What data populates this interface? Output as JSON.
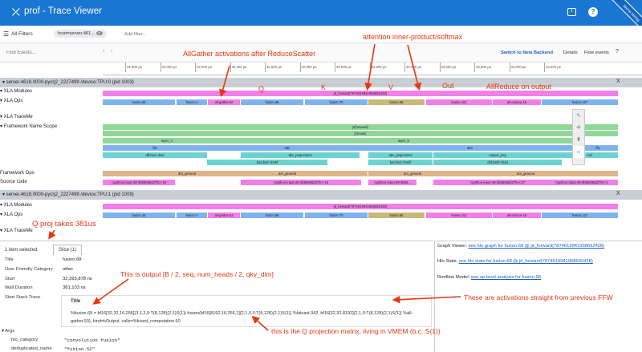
{
  "app": {
    "title": "prof - Trace Viewer",
    "hiring": "We're Hiring"
  },
  "filters": {
    "all_filters": "All Filters",
    "host_chip": "host=server.461...",
    "add_filter_placeholder": "Add filter..."
  },
  "search": {
    "placeholder": "Find Events...",
    "switch_backend": "Switch to New Backend",
    "details": "Details",
    "flow_events": "Flow events"
  },
  "ruler": {
    "ticks": [
      "31,800 µs",
      "32,000 µs",
      "32,200 µs",
      "32,400 µs",
      "32,600 µs",
      "32,800 µs",
      "33,000 µs",
      "33,200 µs",
      "33,400 µs",
      "33,600 µs",
      "33,800 µs",
      "34,000 µs",
      "34,200 µs"
    ]
  },
  "process1": {
    "header": "▾ server.4618.0000-pycrj2_2227499 /device:TPU:0 (pid 1003)",
    "rows": [
      "▾ XLA Modules",
      "▾ XLA Ops",
      "▾ XLA TraceMe",
      "▾ Framework Name Scope",
      "Framework Ops",
      "Source code"
    ],
    "module": "jit_forward(7874619941958692428)",
    "ops": [
      "fusion.28",
      "fusion.4",
      "all-gather.52",
      "fusion.68",
      "fusion.70",
      "fusion.66",
      "fusion.151",
      "all-reduce.15",
      "fusion.127"
    ],
    "scope_top": "jit(forward)",
    "scope_main": "jit(main)",
    "layer4": "layer_4",
    "layer5a": "layer_5",
    "layer5b": "layer_5",
    "ffw": "ffw",
    "attn": "attn",
    "attn2": "attn",
    "ffw2": "ffw",
    "ffw_right": "ffw",
    "einsum_left": "dff,bsd->bsd",
    "qkv1": "qkv_projections",
    "qkv2": "qkv_projections",
    "out_proj": "output_proj",
    "einsum_right": "bsf",
    "bsd1": "bsd,bsd->bshf",
    "bsd2": "bsd,bsd->bshf",
    "dhf": "dhf,bshf->bsd",
    "dot1": "dot_general",
    "dot2": "dot_general",
    "dot3": "dot_general",
    "dot4": "dot_general",
    "src1": "<python-input-49-3b56066d27fe>:19",
    "src2": "<python-input-49-3b56066d27fe>:19",
    "src3": "<python-input-49-3b56...",
    "src4": "<python-input-49-3b56066d27fe>:27",
    "src5": "<python-input-49-3b56066d27fe>:1"
  },
  "process2": {
    "header": "▾ server.4618.0000-pycrj2_2227499 /device:TPU:1 (pid 1009)",
    "rows": [
      "▾ XLA Modules",
      "▾ XLA Ops",
      "▾ XLA TraceMe"
    ],
    "module": "jit_forward(7874619941958692428)",
    "ops": [
      "fusion.28",
      "fusion.4",
      "all-gather.53",
      "fusion.68",
      "fusion.70",
      "fusion.66",
      "fusion.151",
      "all-reduce.15",
      "fusion.127"
    ]
  },
  "details": {
    "selected": "1 item selected.",
    "tab": "Slice (1)",
    "fields": [
      {
        "label": "Title",
        "value": "fusion.68"
      },
      {
        "label": "User Friendly Category",
        "value": "other"
      },
      {
        "label": "Start",
        "value": "32,393,878 ns"
      },
      {
        "label": "Wall Duration",
        "value": "381,103 ns"
      },
      {
        "label": "Start Stack Trace",
        "value": ""
      }
    ],
    "stack_title": "Title",
    "stack_text": "%fusion.68 = bf16[32,32,16,256]{3,1,2,0:T(8,128)(2,1)S(1)} fusion(bf16[8192,16,256,1]{2,1,0,3:T(8,128)(2,1)S(1)} %bitcast.342, bf16[32,32,8192]{2,1,0:T(8,128)(2,1)S(1)} %all-gather.53), kind=kOutput, calls=%fused_computation.60",
    "args_label": "▾ Args",
    "args": [
      {
        "k": "hlo_category",
        "v": "\"convolution fusion\""
      },
      {
        "k": "deduplicated_name",
        "v": "\"fusion.52\""
      }
    ]
  },
  "right": {
    "graph_label": "Graph Viewer:",
    "graph_link": "see hlo graph for fusion.68 @ jit_forward(7874619941958692428)",
    "stats_label": "Hlo Stats:",
    "stats_link": "see hlo stats for fusion.68 @ jit_forward(7874619941958692428)",
    "roofline_label": "Roofline Model:",
    "roofline_link": "see op level analysis for fusion.68"
  },
  "annotations": {
    "allgather": "AllGather activations after ReduceScatter",
    "attention": "attention inner-product/softmax",
    "q": "Q",
    "k": "K",
    "v": "V",
    "out": "Out",
    "allreduce": "AllReduce on output",
    "qproj": "Q proj takes 381us",
    "output_shape": "This is output [B / 2, seq, num_heads / 2, qkv_dim]",
    "prev_ffw": "These are activations straight from previous FFW",
    "qmatrix": "this is the Q projection matrix, living in VMEM (b.c. S(1))"
  },
  "colors": {
    "appbar": "#1976d2",
    "annotation": "#e8360e",
    "pink": "#f27ee8",
    "blue": "#7fb3f0",
    "olive": "#c9b87a",
    "green": "#8fd89a",
    "teal": "#6ad3cf",
    "tan": "#dfb48a"
  }
}
